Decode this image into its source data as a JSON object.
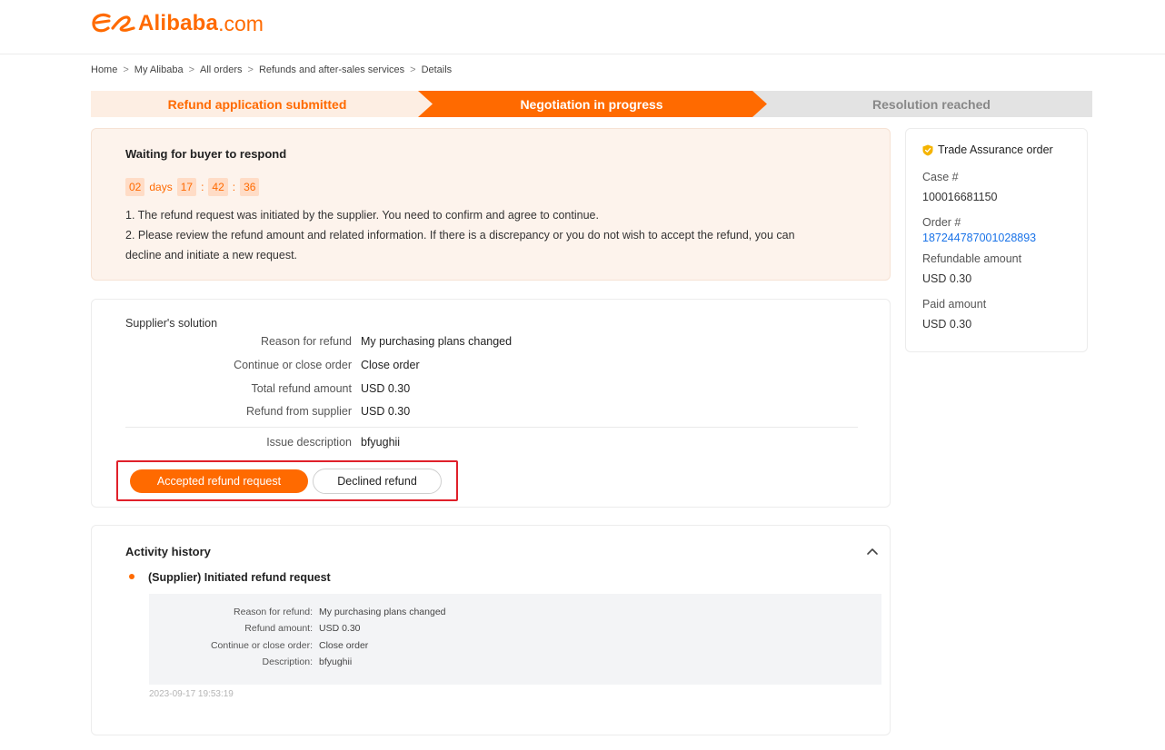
{
  "brand": {
    "name": "Alibaba",
    "tld": ".com",
    "accent_color": "#ff6a00"
  },
  "breadcrumb": [
    "Home",
    "My Alibaba",
    "All orders",
    "Refunds and after-sales services",
    "Details"
  ],
  "breadcrumb_separator": ">",
  "steps": [
    {
      "label": "Refund application submitted",
      "state": "done"
    },
    {
      "label": "Negotiation in progress",
      "state": "active"
    },
    {
      "label": "Resolution reached",
      "state": "pending"
    }
  ],
  "notice": {
    "title": "Waiting for buyer to respond",
    "countdown": {
      "days": "02",
      "days_label": "days",
      "hours": "17",
      "minutes": "42",
      "seconds": "36",
      "separator": ":"
    },
    "line1": "1. The refund request was initiated by the supplier. You need to confirm and agree to continue.",
    "line2": "2. Please review the refund amount and related information. If there is a discrepancy or you do not wish to accept the refund, you can",
    "line3": "decline and initiate a new request."
  },
  "solution": {
    "title": "Supplier's solution",
    "rows": [
      {
        "label": "Reason for refund",
        "value": "My purchasing plans changed"
      },
      {
        "label": "Continue or close order",
        "value": "Close order"
      },
      {
        "label": "Total refund amount",
        "value": "USD 0.30"
      },
      {
        "label": "Refund from supplier",
        "value": "USD 0.30"
      }
    ],
    "issue": {
      "label": "Issue description",
      "value": "bfyughii"
    },
    "accept_label": "Accepted refund request",
    "decline_label": "Declined refund"
  },
  "activity": {
    "title": "Activity history",
    "event_title": "(Supplier) Initiated refund request",
    "details": [
      {
        "label": "Reason for refund:",
        "value": "My purchasing plans changed"
      },
      {
        "label": "Refund amount:",
        "value": "USD 0.30"
      },
      {
        "label": "Continue or close order:",
        "value": "Close order"
      },
      {
        "label": "Description:",
        "value": "bfyughii"
      }
    ],
    "timestamp": "2023-09-17 19:53:19",
    "toggle_icon": "chevron-up-icon"
  },
  "sidebar": {
    "badge_icon": "shield-icon",
    "title": "Trade Assurance order",
    "case_label": "Case #",
    "case_value": "100016681150",
    "order_label": "Order #",
    "order_value": "187244787001028893",
    "refundable_label": "Refundable amount",
    "refundable_value": "USD 0.30",
    "paid_label": "Paid amount",
    "paid_value": "USD 0.30"
  }
}
